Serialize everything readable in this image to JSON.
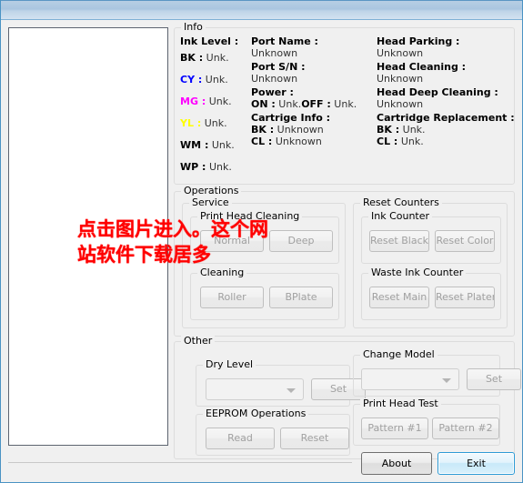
{
  "window": {
    "titlebar_text": ""
  },
  "info": {
    "group_label": "Info",
    "ink_level": {
      "header": "Ink Level :",
      "rows": [
        {
          "tag": "BK",
          "sep": ":",
          "value": "Unk.",
          "color": "#000000"
        },
        {
          "tag": "CY",
          "sep": ":",
          "value": "Unk.",
          "color": "#0000ff"
        },
        {
          "tag": "MG",
          "sep": ":",
          "value": "Unk.",
          "color": "#ff00ff"
        },
        {
          "tag": "YL",
          "sep": ":",
          "value": "Unk.",
          "color": "#ffff00"
        },
        {
          "tag": "WM",
          "sep": ":",
          "value": "Unk.",
          "color": "#000000"
        },
        {
          "tag": "WP",
          "sep": ":",
          "value": "Unk.",
          "color": "#000000"
        }
      ]
    },
    "port_name": {
      "header": "Port Name :",
      "value": "Unknown"
    },
    "port_sn": {
      "header": "Port S/N :",
      "value": "Unknown"
    },
    "power": {
      "header": "Power :",
      "on_label": "ON :",
      "on_value": "Unk.",
      "off_label": "OFF :",
      "off_value": "Unk."
    },
    "cartrige_info": {
      "header": "Cartrige Info :",
      "bk_label": "BK :",
      "bk_value": "Unknown",
      "cl_label": "CL :",
      "cl_value": "Unknown"
    },
    "head_parking": {
      "header": "Head Parking :",
      "value": "Unknown"
    },
    "head_cleaning": {
      "header": "Head Cleaning :",
      "value": "Unknown"
    },
    "head_deep_cleaning": {
      "header": "Head Deep Cleaning :",
      "value": "Unknown"
    },
    "cartridge_replacement": {
      "header": "Cartridge Replacement :",
      "bk_label": "BK :",
      "bk_value": "Unk.",
      "cl_label": "CL :",
      "cl_value": "Unk."
    }
  },
  "operations": {
    "group_label": "Operations",
    "service": {
      "label": "Service",
      "print_head_cleaning": {
        "label": "Print Head Cleaning",
        "normal_button": "Normal",
        "deep_button": "Deep"
      },
      "cleaning": {
        "label": "Cleaning",
        "roller_button": "Roller",
        "bplate_button": "BPlate"
      }
    },
    "reset_counters": {
      "label": "Reset Counters",
      "ink_counter": {
        "label": "Ink Counter",
        "reset_black_button": "Reset Black",
        "reset_color_button": "Reset Color"
      },
      "waste_ink_counter": {
        "label": "Waste Ink Counter",
        "reset_main_button": "Reset Main",
        "reset_platen_button": "Reset Platen"
      }
    }
  },
  "other": {
    "group_label": "Other",
    "dry_level": {
      "label": "Dry Level",
      "selected": "",
      "set_button": "Set"
    },
    "eeprom_operations": {
      "label": "EEPROM Operations",
      "read_button": "Read",
      "reset_button": "Reset"
    },
    "change_model": {
      "label": "Change Model",
      "selected": "",
      "set_button": "Set"
    },
    "print_head_test": {
      "label": "Print Head Test",
      "pattern1_button": "Pattern #1",
      "pattern2_button": "Pattern #2"
    }
  },
  "footer": {
    "about_button": "About",
    "exit_button": "Exit"
  },
  "watermark": {
    "line1": "点击图片进入。这个网",
    "line2": "站软件下载居多",
    "color": "#ff0000"
  }
}
